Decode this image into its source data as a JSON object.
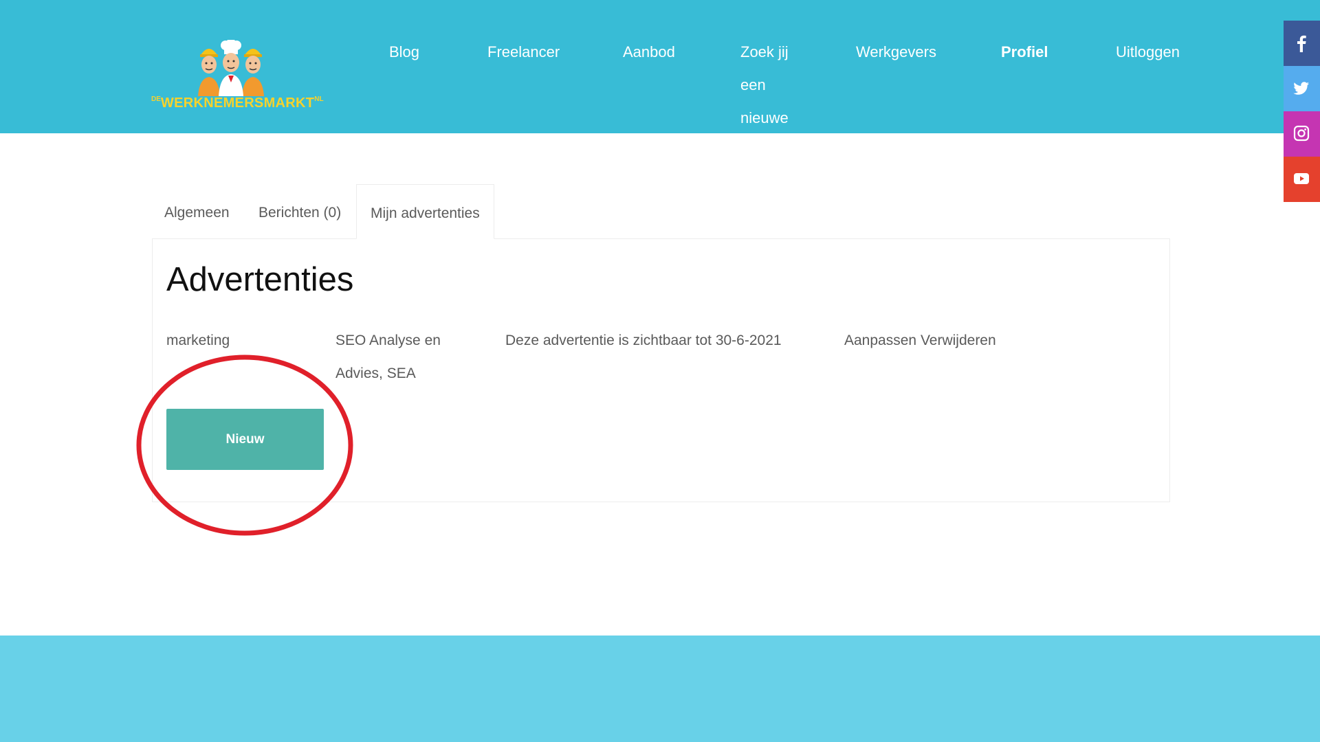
{
  "brand": {
    "prefix": "DE",
    "name": "WERKNEMERSMARKT",
    "suffix": "NL",
    "color": "#f6d22d"
  },
  "nav": {
    "items": [
      {
        "label": "Blog",
        "active": false
      },
      {
        "label": "Freelancer",
        "active": false
      },
      {
        "label": "Aanbod",
        "active": false
      },
      {
        "label": "Zoek jij een nieuwe",
        "active": false
      },
      {
        "label": "Werkgevers",
        "active": false
      },
      {
        "label": "Profiel",
        "active": true
      },
      {
        "label": "Uitloggen",
        "active": false
      }
    ]
  },
  "social": [
    {
      "icon": "facebook-icon",
      "color": "#3b5998"
    },
    {
      "icon": "twitter-icon",
      "color": "#55acee"
    },
    {
      "icon": "instagram-icon",
      "color": "#c535b2"
    },
    {
      "icon": "youtube-icon",
      "color": "#e5412d"
    }
  ],
  "tabs": [
    {
      "label": "Algemeen",
      "active": false
    },
    {
      "label": "Berichten (0)",
      "active": false
    },
    {
      "label": "Mijn advertenties",
      "active": true
    }
  ],
  "panel": {
    "title": "Advertenties",
    "ads": [
      {
        "category": "marketing",
        "title": "SEO Analyse en Advies, SEA",
        "visibility": "Deze advertentie is zichtbaar tot 30-6-2021",
        "edit_label": "Aanpassen",
        "delete_label": "Verwijderen"
      }
    ],
    "new_button_label": "Nieuw"
  },
  "colors": {
    "header": "#38bcd6",
    "footer": "#68d1e8",
    "button": "#4fb3a8",
    "highlight": "#e0202a"
  }
}
